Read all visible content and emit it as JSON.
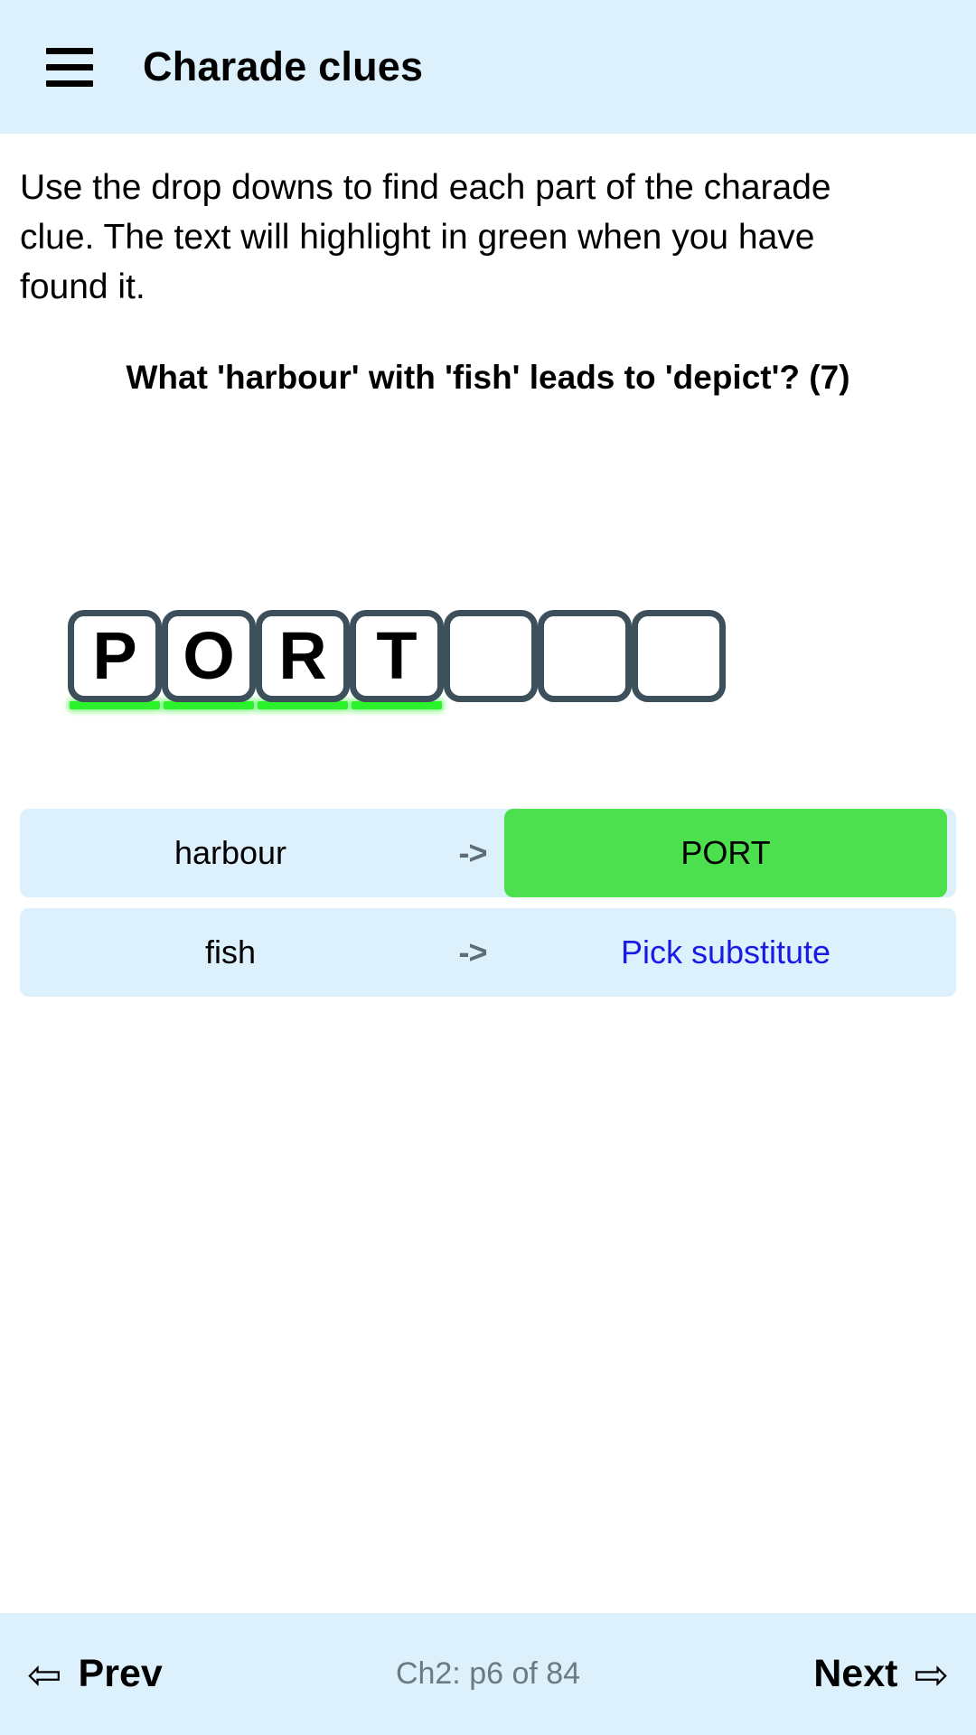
{
  "header": {
    "menu_icon": "hamburger-menu-icon",
    "title": "Charade clues"
  },
  "main": {
    "instructions": "Use the drop downs to find each part of the charade clue. The text will highlight in green when you have found it.",
    "clue": "What 'harbour' with 'fish' leads to 'depict'? (7)",
    "answer": {
      "length": 7,
      "tiles": [
        {
          "letter": "P",
          "found": true
        },
        {
          "letter": "O",
          "found": true
        },
        {
          "letter": "R",
          "found": true
        },
        {
          "letter": "T",
          "found": true
        },
        {
          "letter": "",
          "found": false
        },
        {
          "letter": "",
          "found": false
        },
        {
          "letter": "",
          "found": false
        }
      ]
    },
    "substitutions": [
      {
        "term": "harbour",
        "arrow": "->",
        "value": "PORT",
        "filled": true
      },
      {
        "term": "fish",
        "arrow": "->",
        "value": "Pick substitute",
        "filled": false
      }
    ]
  },
  "navbar": {
    "prev_arrow": "⇦",
    "prev_label": "Prev",
    "page_info": "Ch2: p6 of 84",
    "next_label": "Next",
    "next_arrow": "⇨"
  },
  "colors": {
    "header_bg": "#ddf1fd",
    "row_bg": "#ddf1fc",
    "found_green": "#4ce04e",
    "underline_green": "#2bf22b",
    "link_blue": "#1a1ae6",
    "tile_border": "#3d4f5a",
    "page_info_gray": "#6b7b85",
    "arrow_gray": "#5f6c73"
  }
}
